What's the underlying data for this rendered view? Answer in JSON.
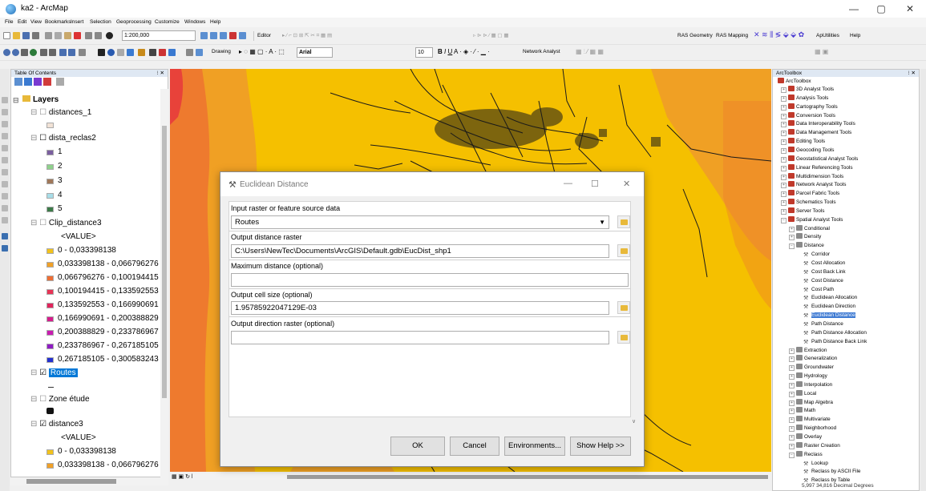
{
  "window": {
    "title": "ka2 - ArcMap",
    "controls": [
      "—",
      "▢",
      "✕"
    ]
  },
  "menus": [
    "File",
    "Edit",
    "View",
    "Bookmarks",
    "Insert",
    "Selection",
    "Geoprocessing",
    "Customize",
    "Windows",
    "Help"
  ],
  "toolbar": {
    "scale": "1:200,000",
    "editor_label": "Editor",
    "drawing_label": "Drawing",
    "font_name": "Arial",
    "font_size": "10",
    "network_analyst_label": "Network Analyst",
    "ras_geometry_label": "RAS Geometry",
    "ras_mapping_label": "RAS Mapping",
    "aputilities_label": "ApUtilities",
    "help_label": "Help"
  },
  "toc": {
    "header": "Table Of Contents",
    "root": "Layers",
    "layers": [
      {
        "name": "distances_1",
        "checked": false
      },
      {
        "name": "dista_reclas2",
        "checked": false,
        "classes": [
          {
            "label": "1",
            "color": "#7b5fa0"
          },
          {
            "label": "2",
            "color": "#8fd18c"
          },
          {
            "label": "3",
            "color": "#a0785a"
          },
          {
            "label": "4",
            "color": "#a8dde8"
          },
          {
            "label": "5",
            "color": "#3c7a48"
          }
        ]
      },
      {
        "name": "Clip_distance3",
        "checked": false,
        "value_label": "<VALUE>",
        "classes": [
          {
            "label": "0 - 0,033398138",
            "color": "#f2c21c"
          },
          {
            "label": "0,033398138 - 0,066796276",
            "color": "#f0a028"
          },
          {
            "label": "0,066796276 - 0,100194415",
            "color": "#ee6e34"
          },
          {
            "label": "0,100194415 - 0,133592553",
            "color": "#e83456"
          },
          {
            "label": "0,133592553 - 0,166990691",
            "color": "#e0245c"
          },
          {
            "label": "0,166990691 - 0,200388829",
            "color": "#d61c8c"
          },
          {
            "label": "0,200388829 - 0,233786967",
            "color": "#c81cb0"
          },
          {
            "label": "0,233786967 - 0,267185105",
            "color": "#8f1cc4"
          },
          {
            "label": "0,267185105 - 0,300583243",
            "color": "#2430d0"
          }
        ]
      },
      {
        "name": "Routes",
        "checked": true,
        "selected": true
      },
      {
        "name": "Zone étude",
        "checked": false
      },
      {
        "name": "distance3",
        "checked": true,
        "value_label": "<VALUE>",
        "classes": [
          {
            "label": "0 - 0,033398138",
            "color": "#f2c21c"
          },
          {
            "label": "0,033398138 - 0,066796276",
            "color": "#f0a028"
          }
        ]
      }
    ]
  },
  "toolbox": {
    "header": "ArcToolbox",
    "root": "ArcToolbox",
    "items": [
      {
        "label": "3D Analyst Tools",
        "level": 1
      },
      {
        "label": "Analysis Tools",
        "level": 1
      },
      {
        "label": "Cartography Tools",
        "level": 1
      },
      {
        "label": "Conversion Tools",
        "level": 1
      },
      {
        "label": "Data Interoperability Tools",
        "level": 1
      },
      {
        "label": "Data Management Tools",
        "level": 1
      },
      {
        "label": "Editing Tools",
        "level": 1
      },
      {
        "label": "Geocoding Tools",
        "level": 1
      },
      {
        "label": "Geostatistical Analyst Tools",
        "level": 1
      },
      {
        "label": "Linear Referencing Tools",
        "level": 1
      },
      {
        "label": "Multidimension Tools",
        "level": 1
      },
      {
        "label": "Network Analyst Tools",
        "level": 1
      },
      {
        "label": "Parcel Fabric Tools",
        "level": 1
      },
      {
        "label": "Schematics Tools",
        "level": 1
      },
      {
        "label": "Server Tools",
        "level": 1
      },
      {
        "label": "Spatial Analyst Tools",
        "level": 1
      },
      {
        "label": "Conditional",
        "level": 2
      },
      {
        "label": "Density",
        "level": 2
      },
      {
        "label": "Distance",
        "level": 2
      },
      {
        "label": "Corridor",
        "level": 3
      },
      {
        "label": "Cost Allocation",
        "level": 3
      },
      {
        "label": "Cost Back Link",
        "level": 3
      },
      {
        "label": "Cost Distance",
        "level": 3
      },
      {
        "label": "Cost Path",
        "level": 3
      },
      {
        "label": "Euclidean Allocation",
        "level": 3
      },
      {
        "label": "Euclidean Direction",
        "level": 3
      },
      {
        "label": "Euclidean Distance",
        "level": 3,
        "selected": true
      },
      {
        "label": "Path Distance",
        "level": 3
      },
      {
        "label": "Path Distance Allocation",
        "level": 3
      },
      {
        "label": "Path Distance Back Link",
        "level": 3
      },
      {
        "label": "Extraction",
        "level": 2
      },
      {
        "label": "Generalization",
        "level": 2
      },
      {
        "label": "Groundwater",
        "level": 2
      },
      {
        "label": "Hydrology",
        "level": 2
      },
      {
        "label": "Interpolation",
        "level": 2
      },
      {
        "label": "Local",
        "level": 2
      },
      {
        "label": "Map Algebra",
        "level": 2
      },
      {
        "label": "Math",
        "level": 2
      },
      {
        "label": "Multivariate",
        "level": 2
      },
      {
        "label": "Neighborhood",
        "level": 2
      },
      {
        "label": "Overlay",
        "level": 2
      },
      {
        "label": "Raster Creation",
        "level": 2
      },
      {
        "label": "Reclass",
        "level": 2
      },
      {
        "label": "Lookup",
        "level": 3
      },
      {
        "label": "Reclass by ASCII File",
        "level": 3
      },
      {
        "label": "Reclass by Table",
        "level": 3
      }
    ]
  },
  "status": {
    "coordinates": "5,997  34,816 Decimal Degrees"
  },
  "dialog": {
    "title": "Euclidean Distance",
    "input_label": "Input raster or feature source data",
    "input_value": "Routes",
    "output_label": "Output distance raster",
    "output_value": "C:\\Users\\NewTec\\Documents\\ArcGIS\\Default.gdb\\EucDist_shp1",
    "maxdist_label": "Maximum distance (optional)",
    "maxdist_value": "",
    "cellsize_label": "Output cell size (optional)",
    "cellsize_value": "1.95785922047129E-03",
    "direction_label": "Output direction raster (optional)",
    "direction_value": "",
    "ok_label": "OK",
    "cancel_label": "Cancel",
    "environments_label": "Environments...",
    "showhelp_label": "Show Help >>"
  }
}
